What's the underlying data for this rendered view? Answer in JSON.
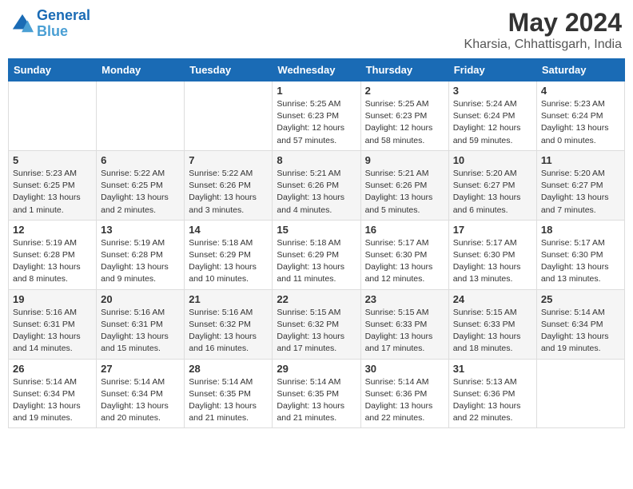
{
  "header": {
    "logo_line1": "General",
    "logo_line2": "Blue",
    "month": "May 2024",
    "location": "Kharsia, Chhattisgarh, India"
  },
  "weekdays": [
    "Sunday",
    "Monday",
    "Tuesday",
    "Wednesday",
    "Thursday",
    "Friday",
    "Saturday"
  ],
  "weeks": [
    [
      {
        "day": "",
        "info": ""
      },
      {
        "day": "",
        "info": ""
      },
      {
        "day": "",
        "info": ""
      },
      {
        "day": "1",
        "info": "Sunrise: 5:25 AM\nSunset: 6:23 PM\nDaylight: 12 hours\nand 57 minutes."
      },
      {
        "day": "2",
        "info": "Sunrise: 5:25 AM\nSunset: 6:23 PM\nDaylight: 12 hours\nand 58 minutes."
      },
      {
        "day": "3",
        "info": "Sunrise: 5:24 AM\nSunset: 6:24 PM\nDaylight: 12 hours\nand 59 minutes."
      },
      {
        "day": "4",
        "info": "Sunrise: 5:23 AM\nSunset: 6:24 PM\nDaylight: 13 hours\nand 0 minutes."
      }
    ],
    [
      {
        "day": "5",
        "info": "Sunrise: 5:23 AM\nSunset: 6:25 PM\nDaylight: 13 hours\nand 1 minute."
      },
      {
        "day": "6",
        "info": "Sunrise: 5:22 AM\nSunset: 6:25 PM\nDaylight: 13 hours\nand 2 minutes."
      },
      {
        "day": "7",
        "info": "Sunrise: 5:22 AM\nSunset: 6:26 PM\nDaylight: 13 hours\nand 3 minutes."
      },
      {
        "day": "8",
        "info": "Sunrise: 5:21 AM\nSunset: 6:26 PM\nDaylight: 13 hours\nand 4 minutes."
      },
      {
        "day": "9",
        "info": "Sunrise: 5:21 AM\nSunset: 6:26 PM\nDaylight: 13 hours\nand 5 minutes."
      },
      {
        "day": "10",
        "info": "Sunrise: 5:20 AM\nSunset: 6:27 PM\nDaylight: 13 hours\nand 6 minutes."
      },
      {
        "day": "11",
        "info": "Sunrise: 5:20 AM\nSunset: 6:27 PM\nDaylight: 13 hours\nand 7 minutes."
      }
    ],
    [
      {
        "day": "12",
        "info": "Sunrise: 5:19 AM\nSunset: 6:28 PM\nDaylight: 13 hours\nand 8 minutes."
      },
      {
        "day": "13",
        "info": "Sunrise: 5:19 AM\nSunset: 6:28 PM\nDaylight: 13 hours\nand 9 minutes."
      },
      {
        "day": "14",
        "info": "Sunrise: 5:18 AM\nSunset: 6:29 PM\nDaylight: 13 hours\nand 10 minutes."
      },
      {
        "day": "15",
        "info": "Sunrise: 5:18 AM\nSunset: 6:29 PM\nDaylight: 13 hours\nand 11 minutes."
      },
      {
        "day": "16",
        "info": "Sunrise: 5:17 AM\nSunset: 6:30 PM\nDaylight: 13 hours\nand 12 minutes."
      },
      {
        "day": "17",
        "info": "Sunrise: 5:17 AM\nSunset: 6:30 PM\nDaylight: 13 hours\nand 13 minutes."
      },
      {
        "day": "18",
        "info": "Sunrise: 5:17 AM\nSunset: 6:30 PM\nDaylight: 13 hours\nand 13 minutes."
      }
    ],
    [
      {
        "day": "19",
        "info": "Sunrise: 5:16 AM\nSunset: 6:31 PM\nDaylight: 13 hours\nand 14 minutes."
      },
      {
        "day": "20",
        "info": "Sunrise: 5:16 AM\nSunset: 6:31 PM\nDaylight: 13 hours\nand 15 minutes."
      },
      {
        "day": "21",
        "info": "Sunrise: 5:16 AM\nSunset: 6:32 PM\nDaylight: 13 hours\nand 16 minutes."
      },
      {
        "day": "22",
        "info": "Sunrise: 5:15 AM\nSunset: 6:32 PM\nDaylight: 13 hours\nand 17 minutes."
      },
      {
        "day": "23",
        "info": "Sunrise: 5:15 AM\nSunset: 6:33 PM\nDaylight: 13 hours\nand 17 minutes."
      },
      {
        "day": "24",
        "info": "Sunrise: 5:15 AM\nSunset: 6:33 PM\nDaylight: 13 hours\nand 18 minutes."
      },
      {
        "day": "25",
        "info": "Sunrise: 5:14 AM\nSunset: 6:34 PM\nDaylight: 13 hours\nand 19 minutes."
      }
    ],
    [
      {
        "day": "26",
        "info": "Sunrise: 5:14 AM\nSunset: 6:34 PM\nDaylight: 13 hours\nand 19 minutes."
      },
      {
        "day": "27",
        "info": "Sunrise: 5:14 AM\nSunset: 6:34 PM\nDaylight: 13 hours\nand 20 minutes."
      },
      {
        "day": "28",
        "info": "Sunrise: 5:14 AM\nSunset: 6:35 PM\nDaylight: 13 hours\nand 21 minutes."
      },
      {
        "day": "29",
        "info": "Sunrise: 5:14 AM\nSunset: 6:35 PM\nDaylight: 13 hours\nand 21 minutes."
      },
      {
        "day": "30",
        "info": "Sunrise: 5:14 AM\nSunset: 6:36 PM\nDaylight: 13 hours\nand 22 minutes."
      },
      {
        "day": "31",
        "info": "Sunrise: 5:13 AM\nSunset: 6:36 PM\nDaylight: 13 hours\nand 22 minutes."
      },
      {
        "day": "",
        "info": ""
      }
    ]
  ]
}
